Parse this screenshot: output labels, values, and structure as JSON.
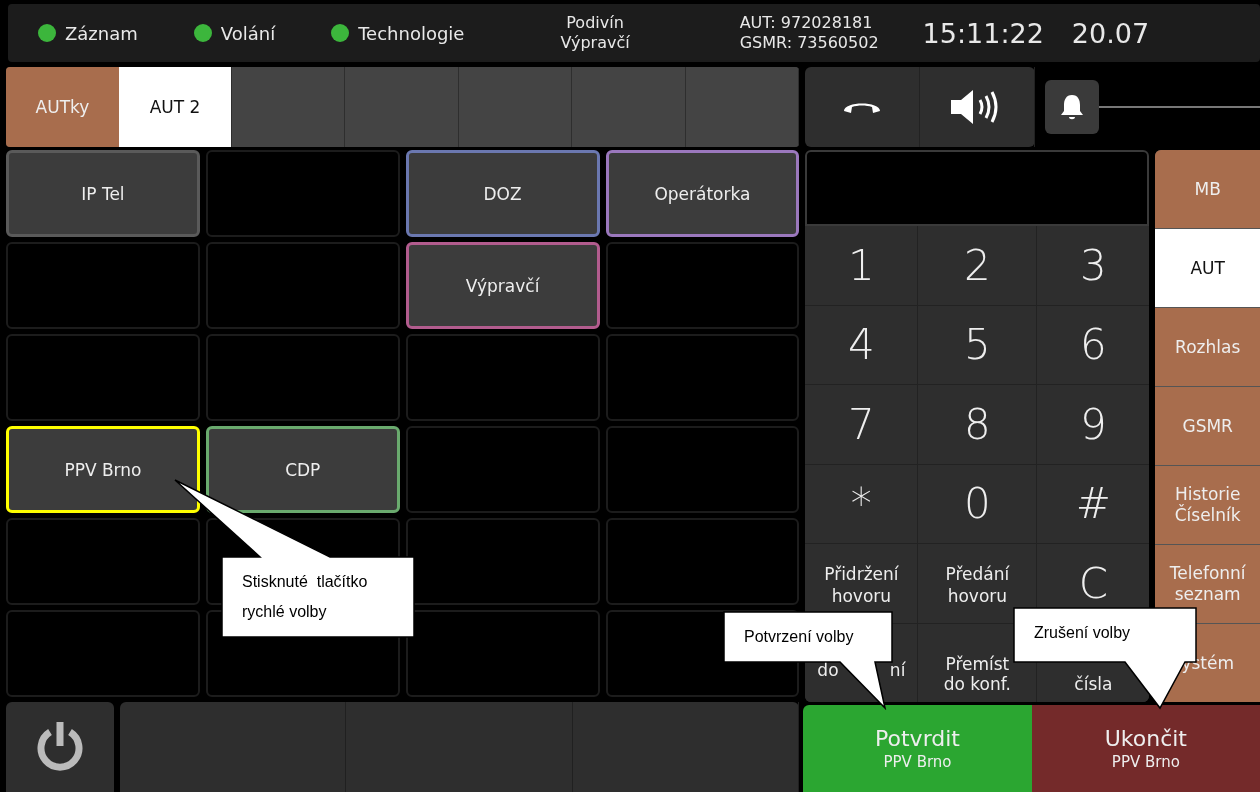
{
  "status_bar": {
    "indicators": [
      {
        "label": "Záznam",
        "color": "#3cb63c"
      },
      {
        "label": "Volání",
        "color": "#3cb63c"
      },
      {
        "label": "Technologie",
        "color": "#3cb63c"
      }
    ],
    "station": [
      "Podivín",
      "Výpravčí"
    ],
    "numbers": [
      "AUT: 972028181",
      "GSMR: 73560502"
    ],
    "time": "15:11:22",
    "date": "20.07"
  },
  "tab_bar": {
    "group_label": "AUTky",
    "tabs": [
      {
        "label": "AUT 2",
        "selected": true
      },
      {
        "selected": false
      },
      {
        "selected": false
      },
      {
        "selected": false
      },
      {
        "selected": false
      },
      {
        "selected": false
      }
    ]
  },
  "quick_dial": [
    {
      "label": "IP Tel",
      "color": "#5a5a5a",
      "selected": false
    },
    {
      "kind": "empty"
    },
    {
      "label": "DOZ",
      "color": "#6b78b0",
      "selected": false
    },
    {
      "label": "Operátorka",
      "color": "#9b78bd",
      "selected": false
    },
    {
      "kind": "empty"
    },
    {
      "kind": "empty"
    },
    {
      "label": "Výpravčí",
      "color": "#b25c8e",
      "selected": false
    },
    {
      "kind": "empty"
    },
    {
      "kind": "empty"
    },
    {
      "kind": "empty"
    },
    {
      "kind": "empty"
    },
    {
      "kind": "empty"
    },
    {
      "label": "PPV Brno",
      "selected": true
    },
    {
      "label": "CDP",
      "color": "#6aaa6e",
      "selected": false
    },
    {
      "kind": "empty"
    },
    {
      "kind": "empty"
    },
    {
      "kind": "empty"
    },
    {
      "kind": "empty"
    },
    {
      "kind": "empty"
    },
    {
      "kind": "empty"
    },
    {
      "kind": "empty"
    },
    {
      "kind": "empty"
    },
    {
      "kind": "empty"
    },
    {
      "kind": "empty"
    }
  ],
  "keypad": [
    {
      "kind": "digit",
      "lines": [
        "1"
      ]
    },
    {
      "kind": "digit",
      "lines": [
        "2"
      ]
    },
    {
      "kind": "digit",
      "lines": [
        "3"
      ]
    },
    {
      "kind": "digit",
      "lines": [
        "4"
      ]
    },
    {
      "kind": "digit",
      "lines": [
        "5"
      ]
    },
    {
      "kind": "digit",
      "lines": [
        "6"
      ]
    },
    {
      "kind": "digit",
      "lines": [
        "7"
      ]
    },
    {
      "kind": "digit",
      "lines": [
        "8"
      ]
    },
    {
      "kind": "digit",
      "lines": [
        "9"
      ]
    },
    {
      "kind": "digit",
      "lines": [
        "*"
      ]
    },
    {
      "kind": "digit",
      "lines": [
        "0"
      ]
    },
    {
      "kind": "digit",
      "lines": [
        "#"
      ]
    },
    {
      "kind": "function",
      "lines": [
        "Přidržení",
        "hovoru"
      ]
    },
    {
      "kind": "function",
      "lines": [
        "Předání",
        "hovoru"
      ]
    },
    {
      "kind": "digit",
      "lines": [
        "C"
      ]
    },
    {
      "kind": "split",
      "lines": [
        "do",
        "ní"
      ]
    },
    {
      "kind": "function",
      "lines": [
        "Přemíst",
        "do konf."
      ]
    },
    {
      "kind": "function",
      "lines": [
        "čísla"
      ]
    }
  ],
  "side_menu": [
    {
      "lines": [
        "MB"
      ],
      "selected": false
    },
    {
      "lines": [
        "AUT"
      ],
      "selected": true
    },
    {
      "lines": [
        "Rozhlas"
      ],
      "selected": false
    },
    {
      "lines": [
        "GSMR"
      ],
      "selected": false
    },
    {
      "lines": [
        "Historie",
        "Číselník"
      ],
      "selected": false
    },
    {
      "lines": [
        "Telefonní",
        "seznam"
      ],
      "selected": false
    },
    {
      "lines": [
        "ystém"
      ],
      "selected": false
    }
  ],
  "actions": [
    {
      "kind": "confirm",
      "label": "Potvrdit",
      "sublabel": "PPV Brno"
    },
    {
      "kind": "end",
      "label": "Ukončit",
      "sublabel": "PPV Brno"
    }
  ],
  "callouts": [
    {
      "lines": [
        "Stisknuté  tlačítko",
        "rychlé volby"
      ]
    },
    {
      "lines": [
        "Potvrzení volby"
      ]
    },
    {
      "lines": [
        "Zrušení volby"
      ]
    }
  ]
}
